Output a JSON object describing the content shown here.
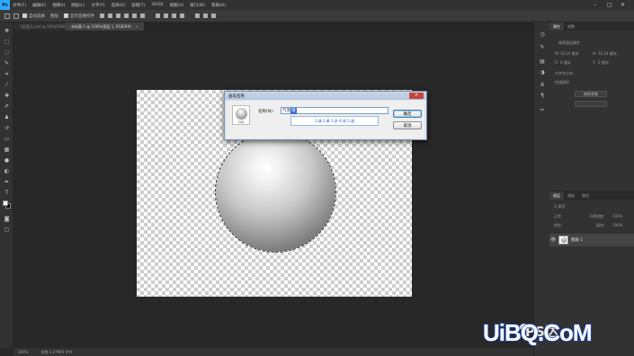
{
  "app": {
    "logo": "Ps"
  },
  "menu": [
    "文件(F)",
    "编辑(E)",
    "图像(I)",
    "图层(L)",
    "文字(Y)",
    "选择(S)",
    "滤镜(T)",
    "3D(D)",
    "视图(V)",
    "窗口(W)",
    "帮助(H)"
  ],
  "options": {
    "auto_select_label": "自动选择",
    "auto_select_value": "图层",
    "show_transform_label": "显示变换控件"
  },
  "tabs": [
    {
      "label": "飞机蓝天.psd @ 50%(RGB/8#)",
      "active": false
    },
    {
      "label": "未标题-1 @ 100%(图层 1, RGB/8#)",
      "active": true
    }
  ],
  "dialog": {
    "title": "画笔名称",
    "name_label": "名称(N):",
    "name_value": "气泡",
    "name_selected": "球",
    "ime_candidates": "1.球 2.裘 3.求 4.俅 5.逑",
    "brush_size": "244",
    "ok_label": "确定",
    "cancel_label": "取消",
    "close_symbol": "✕"
  },
  "status": {
    "zoom": "100%",
    "doc_info": "文档:1.27M/0 字节"
  },
  "properties": {
    "tabs": [
      "属性",
      "调整"
    ],
    "section": "像素图层属性",
    "w_label": "W:",
    "w_value": "10.24 厘米",
    "h_label": "H:",
    "h_value": "10.24 厘米",
    "x_label": "X:",
    "x_value": "0 厘米",
    "y_label": "Y:",
    "y_value": "0 厘米",
    "align_label": "对齐并分布",
    "quick_label": "快速操作",
    "remove_bg": "移除背景"
  },
  "layers": {
    "tabs": [
      "图层",
      "通道",
      "路径"
    ],
    "kind_label": "Q 类型",
    "mode": "正常",
    "opacity_label": "不透明度:",
    "opacity_value": "100%",
    "lock_label": "锁定:",
    "fill_label": "填充:",
    "fill_value": "100%",
    "layer_name": "图层 1",
    "eye_icon": "👁"
  },
  "watermark": {
    "brand": "UiBQ.CoM",
    "channel": "PS达"
  }
}
